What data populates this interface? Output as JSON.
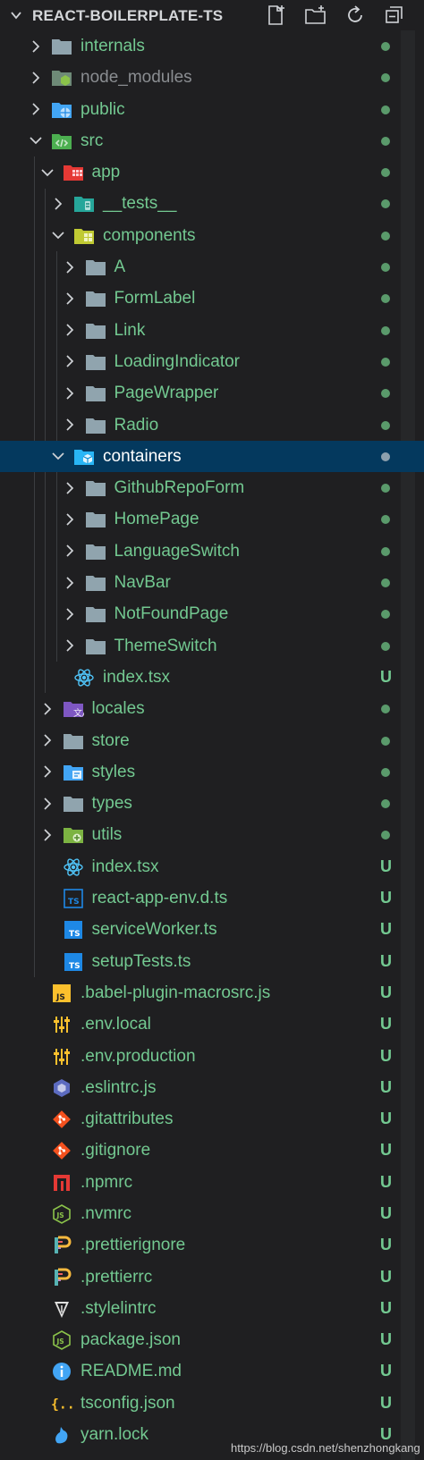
{
  "header": {
    "title": "REACT-BOILERPLATE-TS"
  },
  "tree": [
    {
      "label": "internals",
      "depth": 0,
      "type": "folder",
      "expanded": false,
      "status": "dot",
      "icon": "folder-icon"
    },
    {
      "label": "node_modules",
      "depth": 0,
      "type": "folder",
      "expanded": false,
      "status": "dot",
      "icon": "node-folder-icon",
      "muted": true
    },
    {
      "label": "public",
      "depth": 0,
      "type": "folder",
      "expanded": false,
      "status": "dot",
      "icon": "public-folder-icon"
    },
    {
      "label": "src",
      "depth": 0,
      "type": "folder",
      "expanded": true,
      "status": "dot",
      "icon": "src-folder-icon"
    },
    {
      "label": "app",
      "depth": 1,
      "type": "folder",
      "expanded": true,
      "status": "dot",
      "icon": "app-folder-icon"
    },
    {
      "label": "__tests__",
      "depth": 2,
      "type": "folder",
      "expanded": false,
      "status": "dot",
      "icon": "tests-folder-icon"
    },
    {
      "label": "components",
      "depth": 2,
      "type": "folder",
      "expanded": true,
      "status": "dot",
      "icon": "components-folder-icon"
    },
    {
      "label": "A",
      "depth": 3,
      "type": "folder",
      "expanded": false,
      "status": "dot",
      "icon": "folder-icon"
    },
    {
      "label": "FormLabel",
      "depth": 3,
      "type": "folder",
      "expanded": false,
      "status": "dot",
      "icon": "folder-icon"
    },
    {
      "label": "Link",
      "depth": 3,
      "type": "folder",
      "expanded": false,
      "status": "dot",
      "icon": "folder-icon"
    },
    {
      "label": "LoadingIndicator",
      "depth": 3,
      "type": "folder",
      "expanded": false,
      "status": "dot",
      "icon": "folder-icon"
    },
    {
      "label": "PageWrapper",
      "depth": 3,
      "type": "folder",
      "expanded": false,
      "status": "dot",
      "icon": "folder-icon"
    },
    {
      "label": "Radio",
      "depth": 3,
      "type": "folder",
      "expanded": false,
      "status": "dot",
      "icon": "folder-icon"
    },
    {
      "label": "containers",
      "depth": 2,
      "type": "folder",
      "expanded": true,
      "status": "dot",
      "icon": "containers-folder-icon",
      "selected": true
    },
    {
      "label": "GithubRepoForm",
      "depth": 3,
      "type": "folder",
      "expanded": false,
      "status": "dot",
      "icon": "folder-icon"
    },
    {
      "label": "HomePage",
      "depth": 3,
      "type": "folder",
      "expanded": false,
      "status": "dot",
      "icon": "folder-icon"
    },
    {
      "label": "LanguageSwitch",
      "depth": 3,
      "type": "folder",
      "expanded": false,
      "status": "dot",
      "icon": "folder-icon"
    },
    {
      "label": "NavBar",
      "depth": 3,
      "type": "folder",
      "expanded": false,
      "status": "dot",
      "icon": "folder-icon"
    },
    {
      "label": "NotFoundPage",
      "depth": 3,
      "type": "folder",
      "expanded": false,
      "status": "dot",
      "icon": "folder-icon"
    },
    {
      "label": "ThemeSwitch",
      "depth": 3,
      "type": "folder",
      "expanded": false,
      "status": "dot",
      "icon": "folder-icon"
    },
    {
      "label": "index.tsx",
      "depth": 2,
      "type": "file",
      "status": "U",
      "icon": "react-icon"
    },
    {
      "label": "locales",
      "depth": 1,
      "type": "folder",
      "expanded": false,
      "status": "dot",
      "icon": "locales-folder-icon"
    },
    {
      "label": "store",
      "depth": 1,
      "type": "folder",
      "expanded": false,
      "status": "dot",
      "icon": "folder-icon"
    },
    {
      "label": "styles",
      "depth": 1,
      "type": "folder",
      "expanded": false,
      "status": "dot",
      "icon": "styles-folder-icon"
    },
    {
      "label": "types",
      "depth": 1,
      "type": "folder",
      "expanded": false,
      "status": "dot",
      "icon": "folder-icon"
    },
    {
      "label": "utils",
      "depth": 1,
      "type": "folder",
      "expanded": false,
      "status": "dot",
      "icon": "utils-folder-icon"
    },
    {
      "label": "index.tsx",
      "depth": 1,
      "type": "file",
      "status": "U",
      "icon": "react-icon"
    },
    {
      "label": "react-app-env.d.ts",
      "depth": 1,
      "type": "file",
      "status": "U",
      "icon": "ts-def-icon"
    },
    {
      "label": "serviceWorker.ts",
      "depth": 1,
      "type": "file",
      "status": "U",
      "icon": "ts-icon"
    },
    {
      "label": "setupTests.ts",
      "depth": 1,
      "type": "file",
      "status": "U",
      "icon": "ts-icon"
    },
    {
      "label": ".babel-plugin-macrosrc.js",
      "depth": 0,
      "type": "file",
      "status": "U",
      "icon": "js-icon"
    },
    {
      "label": ".env.local",
      "depth": 0,
      "type": "file",
      "status": "U",
      "icon": "env-icon"
    },
    {
      "label": ".env.production",
      "depth": 0,
      "type": "file",
      "status": "U",
      "icon": "env-icon"
    },
    {
      "label": ".eslintrc.js",
      "depth": 0,
      "type": "file",
      "status": "U",
      "icon": "eslint-icon"
    },
    {
      "label": ".gitattributes",
      "depth": 0,
      "type": "file",
      "status": "U",
      "icon": "git-icon"
    },
    {
      "label": ".gitignore",
      "depth": 0,
      "type": "file",
      "status": "U",
      "icon": "git-icon"
    },
    {
      "label": ".npmrc",
      "depth": 0,
      "type": "file",
      "status": "U",
      "icon": "npm-icon"
    },
    {
      "label": ".nvmrc",
      "depth": 0,
      "type": "file",
      "status": "U",
      "icon": "node-icon"
    },
    {
      "label": ".prettierignore",
      "depth": 0,
      "type": "file",
      "status": "U",
      "icon": "prettier-icon"
    },
    {
      "label": ".prettierrc",
      "depth": 0,
      "type": "file",
      "status": "U",
      "icon": "prettier-icon"
    },
    {
      "label": ".stylelintrc",
      "depth": 0,
      "type": "file",
      "status": "U",
      "icon": "stylelint-icon"
    },
    {
      "label": "package.json",
      "depth": 0,
      "type": "file",
      "status": "U",
      "icon": "node-icon"
    },
    {
      "label": "README.md",
      "depth": 0,
      "type": "file",
      "status": "U",
      "icon": "info-icon"
    },
    {
      "label": "tsconfig.json",
      "depth": 0,
      "type": "file",
      "status": "U",
      "icon": "json-icon"
    },
    {
      "label": "yarn.lock",
      "depth": 0,
      "type": "file",
      "status": "U",
      "icon": "yarn-icon"
    }
  ],
  "colors": {
    "background": "#1f1f21",
    "untracked": "#73c991",
    "selected": "#04395e",
    "folder": "#90a4ae"
  },
  "watermark": "https://blog.csdn.net/shenzhongkang"
}
